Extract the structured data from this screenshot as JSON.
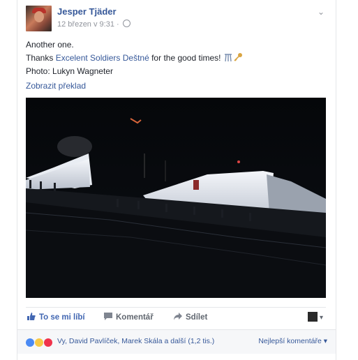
{
  "post": {
    "author": "Jesper Tjäder",
    "timestamp": "12 březen v 9:31 ·",
    "text_line1": "Another one.",
    "text_line2_prefix": "Thanks ",
    "text_line2_link": "Excelent Soldiers Deštné",
    "text_line2_suffix": " for the good times!",
    "text_line3": "Photo: Lukyn Wagneter",
    "translate_link": "Zobrazit překlad"
  },
  "actions": {
    "like": "To se mi líbí",
    "comment": "Komentář",
    "share": "Sdílet"
  },
  "reactions": {
    "names": "Vy, David Pavlíček, Marek Skála a další (1,2 tis.)",
    "best_comments": "Nejlepší komentáře"
  },
  "colors": {
    "link": "#365899",
    "like_blue": "#4267b2"
  },
  "icons": [
    "avatar",
    "globe-icon",
    "chevron-down-icon",
    "thumbs-up-icon",
    "comment-icon",
    "share-arrow-icon",
    "like-reaction-icon",
    "wow-reaction-icon",
    "love-reaction-icon"
  ]
}
